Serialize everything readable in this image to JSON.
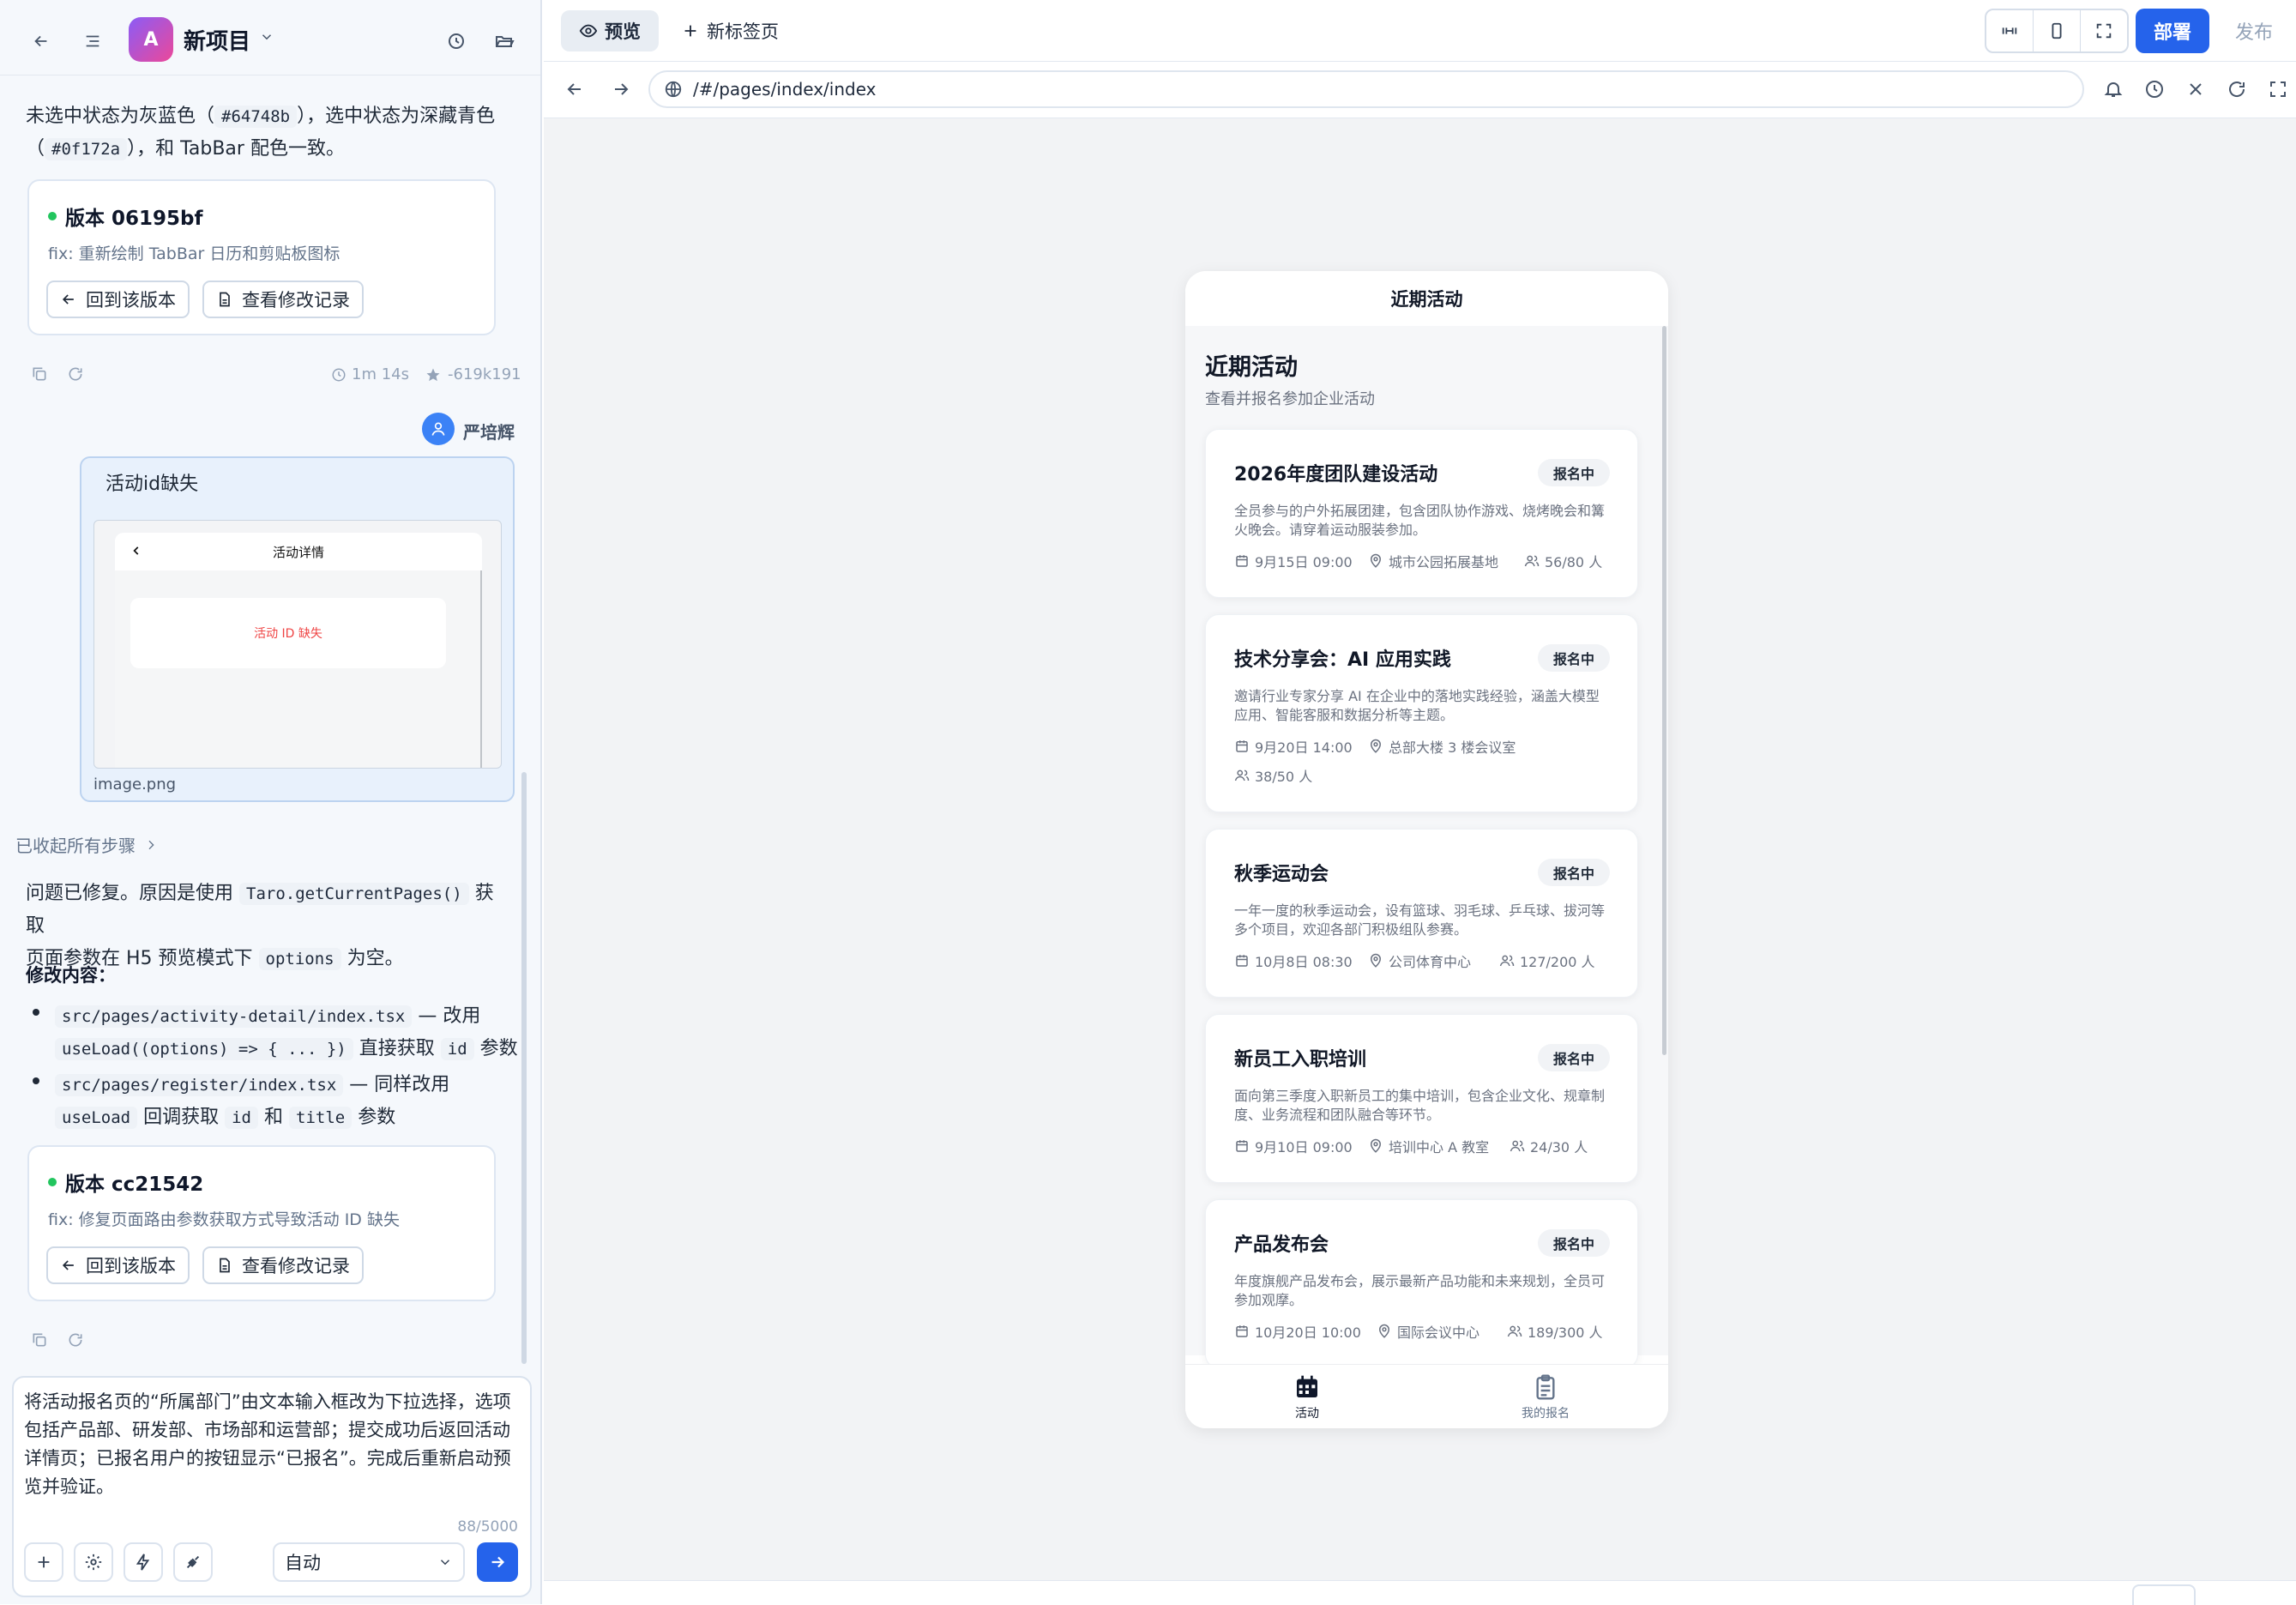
{
  "left_panel": {
    "project_name": "新项目",
    "avatar_letter": "A",
    "intro_text_1": "未选中状态为灰蓝色（",
    "intro_code_1": "#64748b",
    "intro_text_2": "），选中状态为深藏青色",
    "intro_text_3": "（",
    "intro_code_2": "#0f172a",
    "intro_text_4": "），和 TabBar 配色一致。",
    "version_1": {
      "title": "版本 06195bf",
      "desc": "fix: 重新绘制 TabBar 日历和剪贴板图标",
      "rollback_label": "回到该版本",
      "changes_label": "查看修改记录"
    },
    "meta_1": {
      "duration": "1m 14s",
      "tokens": "-619k191"
    },
    "user_name": "严培辉",
    "user_message": "活动id缺失",
    "attachment": {
      "preview_title": "活动详情",
      "preview_error": "活动 ID 缺失",
      "filename": "image.png"
    },
    "collapsed_steps": "已收起所有步骤",
    "reply": {
      "p1_a": "问题已修复。原因是使用",
      "p1_code": "Taro.getCurrentPages()",
      "p1_b": "获取",
      "p1_c": "页面参数在 H5 预览模式下",
      "p1_code2": "options",
      "p1_d": "为空。",
      "heading": "修改内容：",
      "b1_code": "src/pages/activity-detail/index.tsx",
      "b1_a": "— 改用",
      "b1_code2": "useLoad((options) => { ... })",
      "b1_b": "直接获取",
      "b1_code3": "id",
      "b1_c": "参数",
      "b2_code": "src/pages/register/index.tsx",
      "b2_a": "— 同样改用",
      "b2_code2": "useLoad",
      "b2_b": "回调获取",
      "b2_code3": "id",
      "b2_c": "和",
      "b2_code4": "title",
      "b2_d": "参数"
    },
    "version_2": {
      "title": "版本 cc21542",
      "desc": "fix: 修复页面路由参数获取方式导致活动 ID 缺失",
      "rollback_label": "回到该版本",
      "changes_label": "查看修改记录"
    },
    "input": {
      "text": "将活动报名页的“所属部门”由文本输入框改为下拉选择，选项包括产品部、研发部、市场部和运营部；提交成功后返回活动详情页；已报名用户的按钮显示“已报名”。完成后重新启动预览并验证。",
      "counter": "88/5000",
      "mode": "自动"
    }
  },
  "topbar": {
    "preview_tab": "预览",
    "new_tab": "新标签页",
    "deploy": "部署",
    "publish": "发布"
  },
  "address": {
    "url": "/#/pages/index/index"
  },
  "phone": {
    "nav_title": "近期活动",
    "page_title": "近期活动",
    "page_subtitle": "查看并报名参加企业活动",
    "activities": [
      {
        "title": "2026年度团队建设活动",
        "badge": "报名中",
        "desc": "全员参与的户外拓展团建，包含团队协作游戏、烧烤晚会和篝火晚会。请穿着运动服装参加。",
        "date": "9月15日 09:00",
        "location": "城市公园拓展基地",
        "count": "56/80 人"
      },
      {
        "title": "技术分享会：AI 应用实践",
        "badge": "报名中",
        "desc": "邀请行业专家分享 AI 在企业中的落地实践经验，涵盖大模型应用、智能客服和数据分析等主题。",
        "date": "9月20日 14:00",
        "location": "总部大楼 3 楼会议室",
        "count": "38/50 人"
      },
      {
        "title": "秋季运动会",
        "badge": "报名中",
        "desc": "一年一度的秋季运动会，设有篮球、羽毛球、乒乓球、拔河等多个项目，欢迎各部门积极组队参赛。",
        "date": "10月8日 08:30",
        "location": "公司体育中心",
        "count": "127/200 人"
      },
      {
        "title": "新员工入职培训",
        "badge": "报名中",
        "desc": "面向第三季度入职新员工的集中培训，包含企业文化、规章制度、业务流程和团队融合等环节。",
        "date": "9月10日 09:00",
        "location": "培训中心 A 教室",
        "count": "24/30 人"
      },
      {
        "title": "产品发布会",
        "badge": "报名中",
        "desc": "年度旗舰产品发布会，展示最新产品功能和未来规划，全员可参加观摩。",
        "date": "10月20日 10:00",
        "location": "国际会议中心",
        "count": "189/300 人"
      }
    ],
    "tabbar": {
      "tab1": "活动",
      "tab2": "我的报名"
    }
  },
  "colors": {
    "accent": "#2563eb",
    "active_tab": "#0f172a",
    "inactive_tab": "#64748b",
    "success": "#22c55e"
  }
}
